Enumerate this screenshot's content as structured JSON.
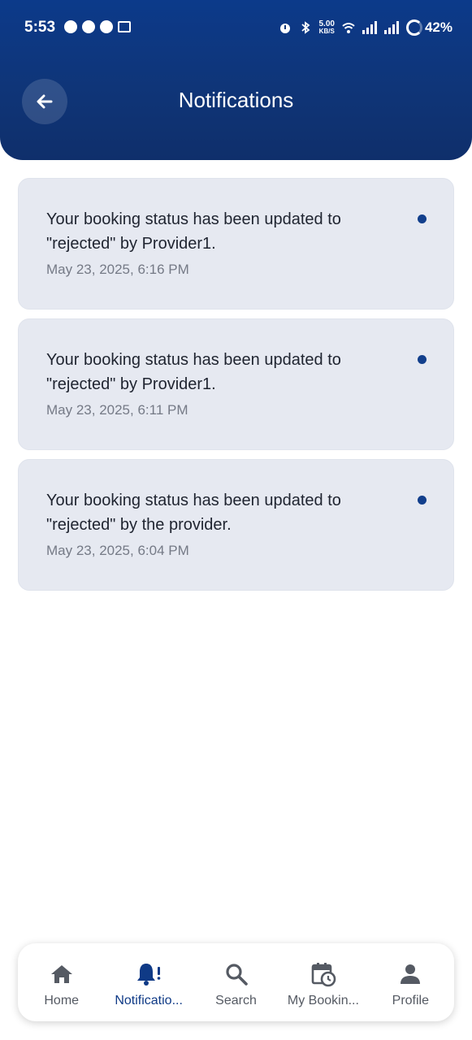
{
  "status_bar": {
    "time": "5:53",
    "network_speed_value": "5.00",
    "network_speed_unit": "KB/S",
    "battery": "42%"
  },
  "header": {
    "title": "Notifications",
    "back_icon": "arrow-left-icon"
  },
  "notifications": [
    {
      "message": "Your booking status has been updated to \"rejected\" by Provider1.",
      "time": "May 23, 2025, 6:16 PM",
      "unread": true
    },
    {
      "message": "Your booking status has been updated to \"rejected\" by Provider1.",
      "time": "May 23, 2025, 6:11 PM",
      "unread": true
    },
    {
      "message": "Your booking status has been updated to \"rejected\" by the provider.",
      "time": "May 23, 2025, 6:04 PM",
      "unread": true
    }
  ],
  "bottom_nav": {
    "items": [
      {
        "label": "Home",
        "icon": "home-icon"
      },
      {
        "label": "Notificatio...",
        "icon": "bell-icon",
        "active": true
      },
      {
        "label": "Search",
        "icon": "search-icon"
      },
      {
        "label": "My Bookin...",
        "icon": "calendar-clock-icon"
      },
      {
        "label": "Profile",
        "icon": "person-icon"
      }
    ]
  },
  "colors": {
    "header_bg": "#0f3578",
    "card_bg": "#e6e9f1",
    "accent": "#0f3a86",
    "unread_dot": "#123f8c"
  }
}
